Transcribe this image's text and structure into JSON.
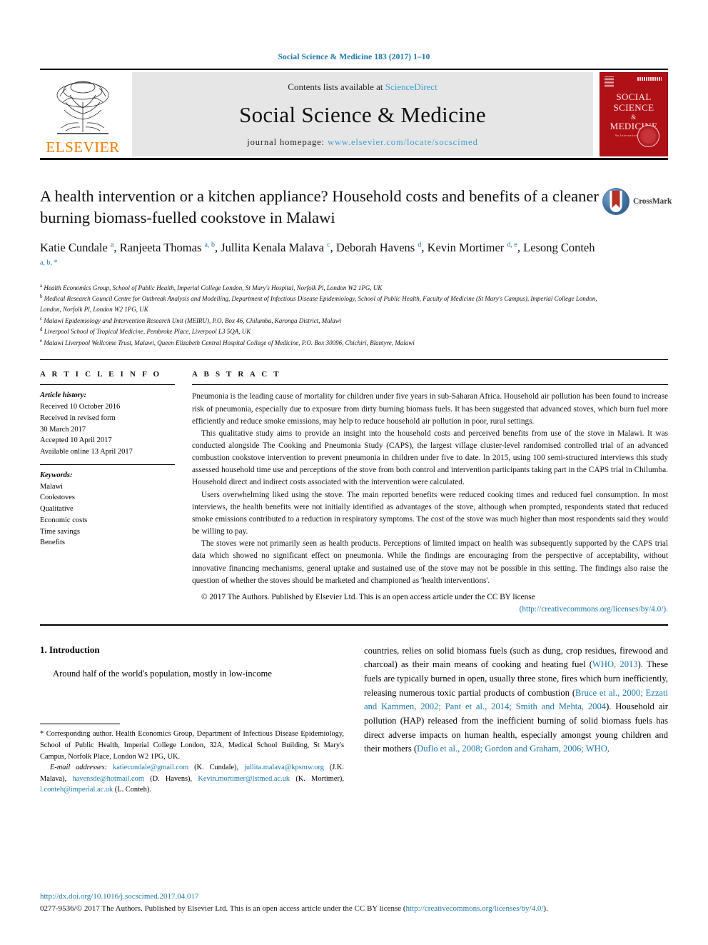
{
  "running_head": "Social Science & Medicine 183 (2017) 1–10",
  "masthead": {
    "publisher": "ELSEVIER",
    "contents_prefix": "Contents lists available at ",
    "contents_link": "ScienceDirect",
    "journal_name": "Social Science & Medicine",
    "homepage_prefix": "journal homepage: ",
    "homepage_url": "www.elsevier.com/locate/socscimed",
    "cover": {
      "line1": "SOCIAL",
      "line2": "SCIENCE",
      "line3": "&",
      "line4": "MEDICINE",
      "tagline": "An International Journal"
    }
  },
  "article": {
    "title": "A health intervention or a kitchen appliance? Household costs and benefits of a cleaner burning biomass-fuelled cookstove in Malawi",
    "crossmark_label": "CrossMark",
    "authors_html": "Katie Cundale <sup>a</sup>, Ranjeeta Thomas <sup>a, b</sup>, Jullita Kenala Malava <sup>c</sup>, Deborah Havens <sup>d</sup>, Kevin Mortimer <sup>d, e</sup>, Lesong Conteh <sup>a, b, *</sup>",
    "affiliations": [
      {
        "label": "a",
        "text": "Health Economics Group, School of Public Health, Imperial College London, St Mary's Hospital, Norfolk Pl, London W2 1PG, UK"
      },
      {
        "label": "b",
        "text": "Medical Research Council Centre for Outbreak Analysis and Modelling, Department of Infectious Disease Epidemiology, School of Public Health, Faculty of Medicine (St Mary's Campus), Imperial College London, London, Norfolk Pl, London W2 1PG, UK"
      },
      {
        "label": "c",
        "text": "Malawi Epidemiology and Intervention Research Unit (MEIRU), P.O. Box 46, Chilumba, Karonga District, Malawi"
      },
      {
        "label": "d",
        "text": "Liverpool School of Tropical Medicine, Pembroke Place, Liverpool L3 5QA, UK"
      },
      {
        "label": "e",
        "text": "Malawi Liverpool Wellcome Trust, Malawi, Queen Elizabeth Central Hospital College of Medicine, P.O. Box 30096, Chichiri, Blantyre, Malawi"
      }
    ]
  },
  "article_info": {
    "heading": "A R T I C L E   I N F O",
    "history_label": "Article history:",
    "history": [
      "Received 10 October 2016",
      "Received in revised form",
      "30 March 2017",
      "Accepted 10 April 2017",
      "Available online 13 April 2017"
    ],
    "keywords_label": "Keywords:",
    "keywords": [
      "Malawi",
      "Cookstoves",
      "Qualitative",
      "Economic costs",
      "Time savings",
      "Benefits"
    ]
  },
  "abstract": {
    "heading": "A B S T R A C T",
    "paragraphs": [
      "Pneumonia is the leading cause of mortality for children under five years in sub-Saharan Africa. Household air pollution has been found to increase risk of pneumonia, especially due to exposure from dirty burning biomass fuels. It has been suggested that advanced stoves, which burn fuel more efficiently and reduce smoke emissions, may help to reduce household air pollution in poor, rural settings.",
      "This qualitative study aims to provide an insight into the household costs and perceived benefits from use of the stove in Malawi. It was conducted alongside The Cooking and Pneumonia Study (CAPS), the largest village cluster-level randomised controlled trial of an advanced combustion cookstove intervention to prevent pneumonia in children under five to date. In 2015, using 100 semi-structured interviews this study assessed household time use and perceptions of the stove from both control and intervention participants taking part in the CAPS trial in Chilumba. Household direct and indirect costs associated with the intervention were calculated.",
      "Users overwhelming liked using the stove. The main reported benefits were reduced cooking times and reduced fuel consumption. In most interviews, the health benefits were not initially identified as advantages of the stove, although when prompted, respondents stated that reduced smoke emissions contributed to a reduction in respiratory symptoms. The cost of the stove was much higher than most respondents said they would be willing to pay.",
      "The stoves were not primarily seen as health products. Perceptions of limited impact on health was subsequently supported by the CAPS trial data which showed no significant effect on pneumonia. While the findings are encouraging from the perspective of acceptability, without innovative financing mechanisms, general uptake and sustained use of the stove may not be possible in this setting. The findings also raise the question of whether the stoves should be marketed and championed as 'health interventions'."
    ],
    "copyright_text": "© 2017 The Authors. Published by Elsevier Ltd. This is an open access article under the CC BY license",
    "license_url": "(http://creativecommons.org/licenses/by/4.0/)."
  },
  "body": {
    "section_number_title": "1.  Introduction",
    "left_paragraph": "Around half of the world's population, mostly in low-income",
    "right_paragraph_part1": "countries, relies on solid biomass fuels (such as dung, crop residues, firewood and charcoal) as their main means of cooking and heating fuel (",
    "right_cite1": "WHO, 2013",
    "right_paragraph_part2": "). These fuels are typically burned in open, usually three stone, fires which burn inefficiently, releasing numerous toxic partial products of combustion (",
    "right_cite2": "Bruce et al., 2000; Ezzati and Kammen, 2002; Pant et al., 2014; Smith and Mehta, 2004",
    "right_paragraph_part3": "). Household air pollution (HAP) released from the inefficient burning of solid biomass fuels has direct adverse impacts on human health, especially amongst young children and their mothers (",
    "right_cite3": "Duflo et al., 2008; Gordon and Graham, 2006; WHO,"
  },
  "footnote": {
    "corresponding": "* Corresponding author. Health Economics Group, Department of Infectious Disease Epidemiology, School of Public Health, Imperial College London, 32A, Medical School Building, St Mary's Campus, Norfolk Place, London W2 1PG, UK.",
    "email_label": "E-mail addresses:",
    "emails": [
      {
        "address": "katiecundale@gmail.com",
        "name": "(K. Cundale)"
      },
      {
        "address": "jullita.malava@kpsmw.org",
        "name": "(J.K. Malava)"
      },
      {
        "address": "havensde@hotmail.com",
        "name": "(D. Havens)"
      },
      {
        "address": "Kevin.mortimer@lstmed.ac.uk",
        "name": "(K. Mortimer)"
      },
      {
        "address": "l.conteh@imperial.ac.uk",
        "name": "(L. Conteh)"
      }
    ]
  },
  "footer": {
    "doi": "http://dx.doi.org/10.1016/j.socscimed.2017.04.017",
    "issn_text": "0277-9536/© 2017 The Authors. Published by Elsevier Ltd. This is an open access article under the CC BY license (",
    "issn_link": "http://creativecommons.org/licenses/by/4.0/",
    "issn_tail": ")."
  },
  "colors": {
    "link": "#1b76a8",
    "cover_red": "#b01116",
    "elsevier_orange": "#f07d00"
  }
}
